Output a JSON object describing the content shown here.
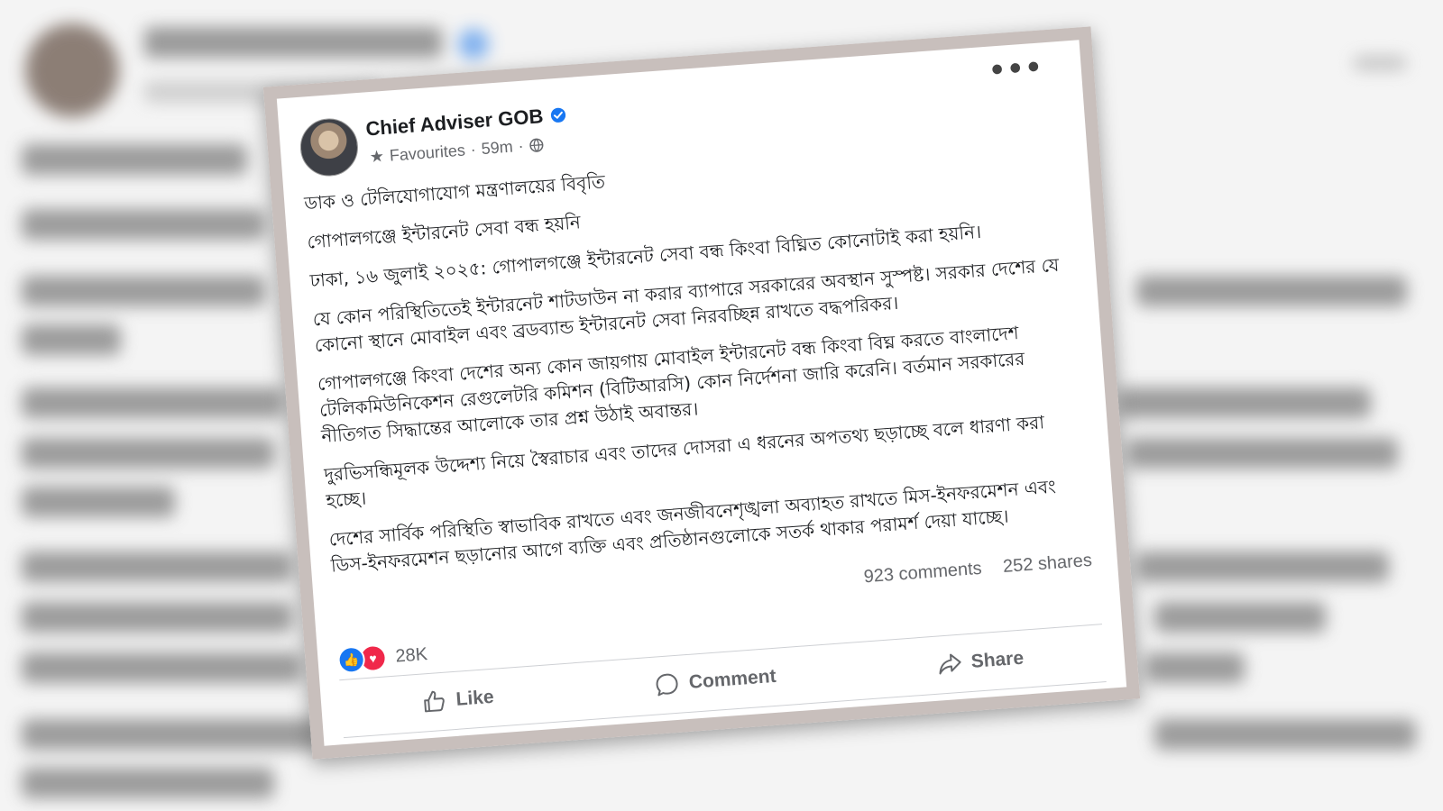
{
  "post": {
    "author": "Chief Adviser GOB",
    "meta": {
      "audience": "Favourites",
      "time": "59m"
    },
    "paragraphs": [
      "ডাক ও টেলিযোগাযোগ মন্ত্রণালয়ের বিবৃতি",
      "গোপালগঞ্জে ইন্টারনেট সেবা বন্ধ হয়নি",
      "ঢাকা, ১৬ জুলাই ২০২৫: গোপালগঞ্জে ইন্টারনেট সেবা বন্ধ কিংবা বিঘ্নিত কোনোটাই করা হয়নি।",
      "যে কোন পরিস্থিতিতেই ইন্টারনেট শাটডাউন না করার ব্যাপারে সরকারের অবস্থান সুস্পষ্ট। সরকার দেশের যে কোনো স্থানে মোবাইল এবং ব্রডব্যান্ড ইন্টারনেট সেবা নিরবচ্ছিন্ন রাখতে বদ্ধপরিকর।",
      "গোপালগঞ্জে কিংবা দেশের অন্য কোন জায়গায় মোবাইল ইন্টারনেট বন্ধ কিংবা বিঘ্ন করতে বাংলাদেশ টেলিকমিউনিকেশন রেগুলেটরি কমিশন (বিটিআরসি) কোন নির্দেশনা জারি করেনি। বর্তমান সরকারের নীতিগত সিদ্ধান্তের আলোকে তার প্রশ্ন উঠাই অবান্তর।",
      "দুরভিসন্ধিমূলক উদ্দেশ্য নিয়ে স্বৈরাচার এবং তাদের দোসরা এ ধরনের অপতথ্য ছড়াচ্ছে বলে ধারণা করা হচ্ছে।",
      "দেশের সার্বিক পরিস্থিতি স্বাভাবিক রাখতে এবং  জনজীবনেশৃঙ্খলা অব্যাহত রাখতে মিস-ইনফরমেশন এবং ডিস-ইনফরমেশন ছড়ানোর আগে ব্যক্তি এবং প্রতিষ্ঠানগুলোকে সতর্ক থাকার পরামর্শ দেয়া যাচ্ছে।"
    ],
    "stats": {
      "reactions": "28K",
      "comments": "923 comments",
      "shares": "252 shares"
    },
    "actions": {
      "like": "Like",
      "comment": "Comment",
      "share": "Share"
    }
  },
  "icons": {
    "more": "more-options-icon",
    "verified": "verified-badge-icon",
    "audience": "star-icon",
    "privacy": "globe-icon",
    "like_reaction": "like-reaction-icon",
    "love_reaction": "love-reaction-icon"
  },
  "colors": {
    "brand_blue": "#1877f2",
    "love_red": "#f0284a",
    "text": "#1c1e21",
    "muted": "#65676b",
    "frame": "#c8bfbc"
  }
}
